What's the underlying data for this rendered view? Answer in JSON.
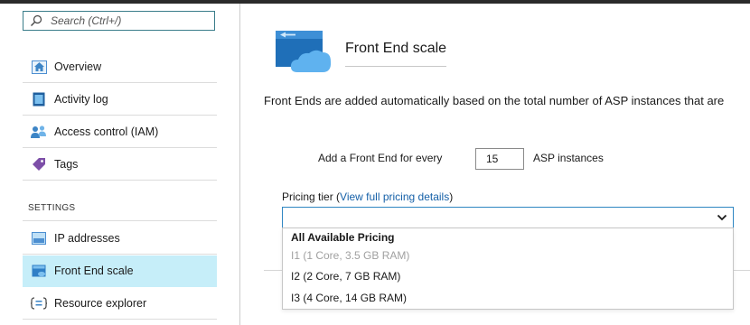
{
  "sidebar": {
    "search_placeholder": "Search (Ctrl+/)",
    "items": [
      {
        "label": "Overview",
        "icon": "overview-icon"
      },
      {
        "label": "Activity log",
        "icon": "activity-log-icon"
      },
      {
        "label": "Access control (IAM)",
        "icon": "access-control-icon"
      },
      {
        "label": "Tags",
        "icon": "tag-icon"
      }
    ],
    "settings_header": "SETTINGS",
    "settings_items": [
      {
        "label": "IP addresses",
        "icon": "ip-addresses-icon",
        "selected": false
      },
      {
        "label": "Front End scale",
        "icon": "front-end-scale-icon",
        "selected": true
      },
      {
        "label": "Resource explorer",
        "icon": "resource-explorer-icon",
        "selected": false
      }
    ]
  },
  "main": {
    "title": "Front End scale",
    "description": "Front Ends are added automatically based on the total number of ASP instances that are",
    "frontend_label": "Add a Front End for every",
    "instances_value": "15",
    "instances_unit": "ASP instances",
    "pricing_label": "Pricing tier",
    "pricing_link_open": "(",
    "pricing_link": "View full pricing details",
    "pricing_link_close": ")",
    "pricing_selected": "",
    "dropdown": {
      "header": "All Available Pricing",
      "options": [
        {
          "label": "I1 (1 Core, 3.5 GB RAM)",
          "disabled": true
        },
        {
          "label": "I2 (2 Core, 7 GB RAM)",
          "disabled": false
        },
        {
          "label": "I3 (4 Core, 14 GB RAM)",
          "disabled": false
        }
      ]
    }
  },
  "colors": {
    "accent": "#2f86c2",
    "selected_background": "#c6eef9",
    "link": "#1560a8"
  }
}
